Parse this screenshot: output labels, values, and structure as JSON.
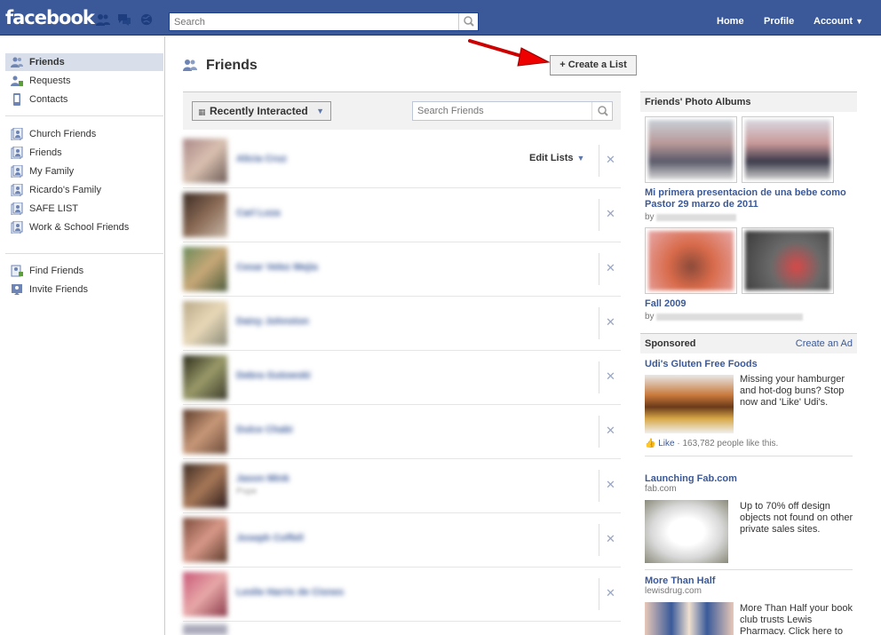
{
  "topbar": {
    "logo": "facebook",
    "search_placeholder": "Search",
    "nav": [
      "Home",
      "Profile",
      "Account"
    ]
  },
  "sidebar": {
    "items": [
      {
        "label": "Friends",
        "icon": "friends-icon",
        "active": true
      },
      {
        "label": "Requests",
        "icon": "requests-icon"
      },
      {
        "label": "Contacts",
        "icon": "contacts-icon"
      },
      {
        "label": "Church Friends",
        "icon": "list-icon"
      },
      {
        "label": "Friends",
        "icon": "list-icon"
      },
      {
        "label": "My Family",
        "icon": "list-icon"
      },
      {
        "label": "Ricardo's Family",
        "icon": "list-icon"
      },
      {
        "label": "SAFE LIST",
        "icon": "list-icon"
      },
      {
        "label": "Work & School Friends",
        "icon": "list-icon"
      },
      {
        "label": "Find Friends",
        "icon": "find-friends-icon"
      },
      {
        "label": "Invite Friends",
        "icon": "invite-friends-icon"
      }
    ]
  },
  "main": {
    "title": "Friends",
    "create_list": "+ Create a List",
    "filter_label": "Recently Interacted",
    "search_placeholder": "Search Friends",
    "edit_lists": "Edit Lists",
    "friends": [
      {
        "name": "Alicia Cruz",
        "sub": ""
      },
      {
        "name": "Carl Loza",
        "sub": ""
      },
      {
        "name": "Cesar Velez Mejia",
        "sub": ""
      },
      {
        "name": "Daisy Johnston",
        "sub": ""
      },
      {
        "name": "Debra Gutowski",
        "sub": ""
      },
      {
        "name": "Dulce Chabi",
        "sub": ""
      },
      {
        "name": "Jason Mink",
        "sub": "Pope"
      },
      {
        "name": "Joseph Coffell",
        "sub": ""
      },
      {
        "name": "Leslie Harris de Cisnes",
        "sub": ""
      }
    ]
  },
  "right": {
    "albums_head": "Friends' Photo Albums",
    "albums": [
      {
        "title": "Mi primera presentacion de una bebe como Pastor 29 marzo de 2011",
        "by": "by"
      },
      {
        "title": "Fall 2009",
        "by": "by"
      }
    ],
    "sponsored_head": "Sponsored",
    "create_ad": "Create an Ad",
    "ads": [
      {
        "title": "Udi's Gluten Free Foods",
        "domain": "",
        "body": "Missing your hamburger and hot-dog buns? Stop now and 'Like' Udi's.",
        "like_label": "Like",
        "like_count": "· 163,782 people like this."
      },
      {
        "title": "Launching Fab.com",
        "domain": "fab.com",
        "body": "Up to 70% off design objects not found on other private sales sites."
      },
      {
        "title": "More Than Half",
        "domain": "lewisdrug.com",
        "body": "More Than Half your book club trusts Lewis Pharmacy. Click here to"
      }
    ]
  },
  "colors": {
    "brand": "#3b5998",
    "link": "#3b5998",
    "active_bg": "#d8dfea"
  }
}
